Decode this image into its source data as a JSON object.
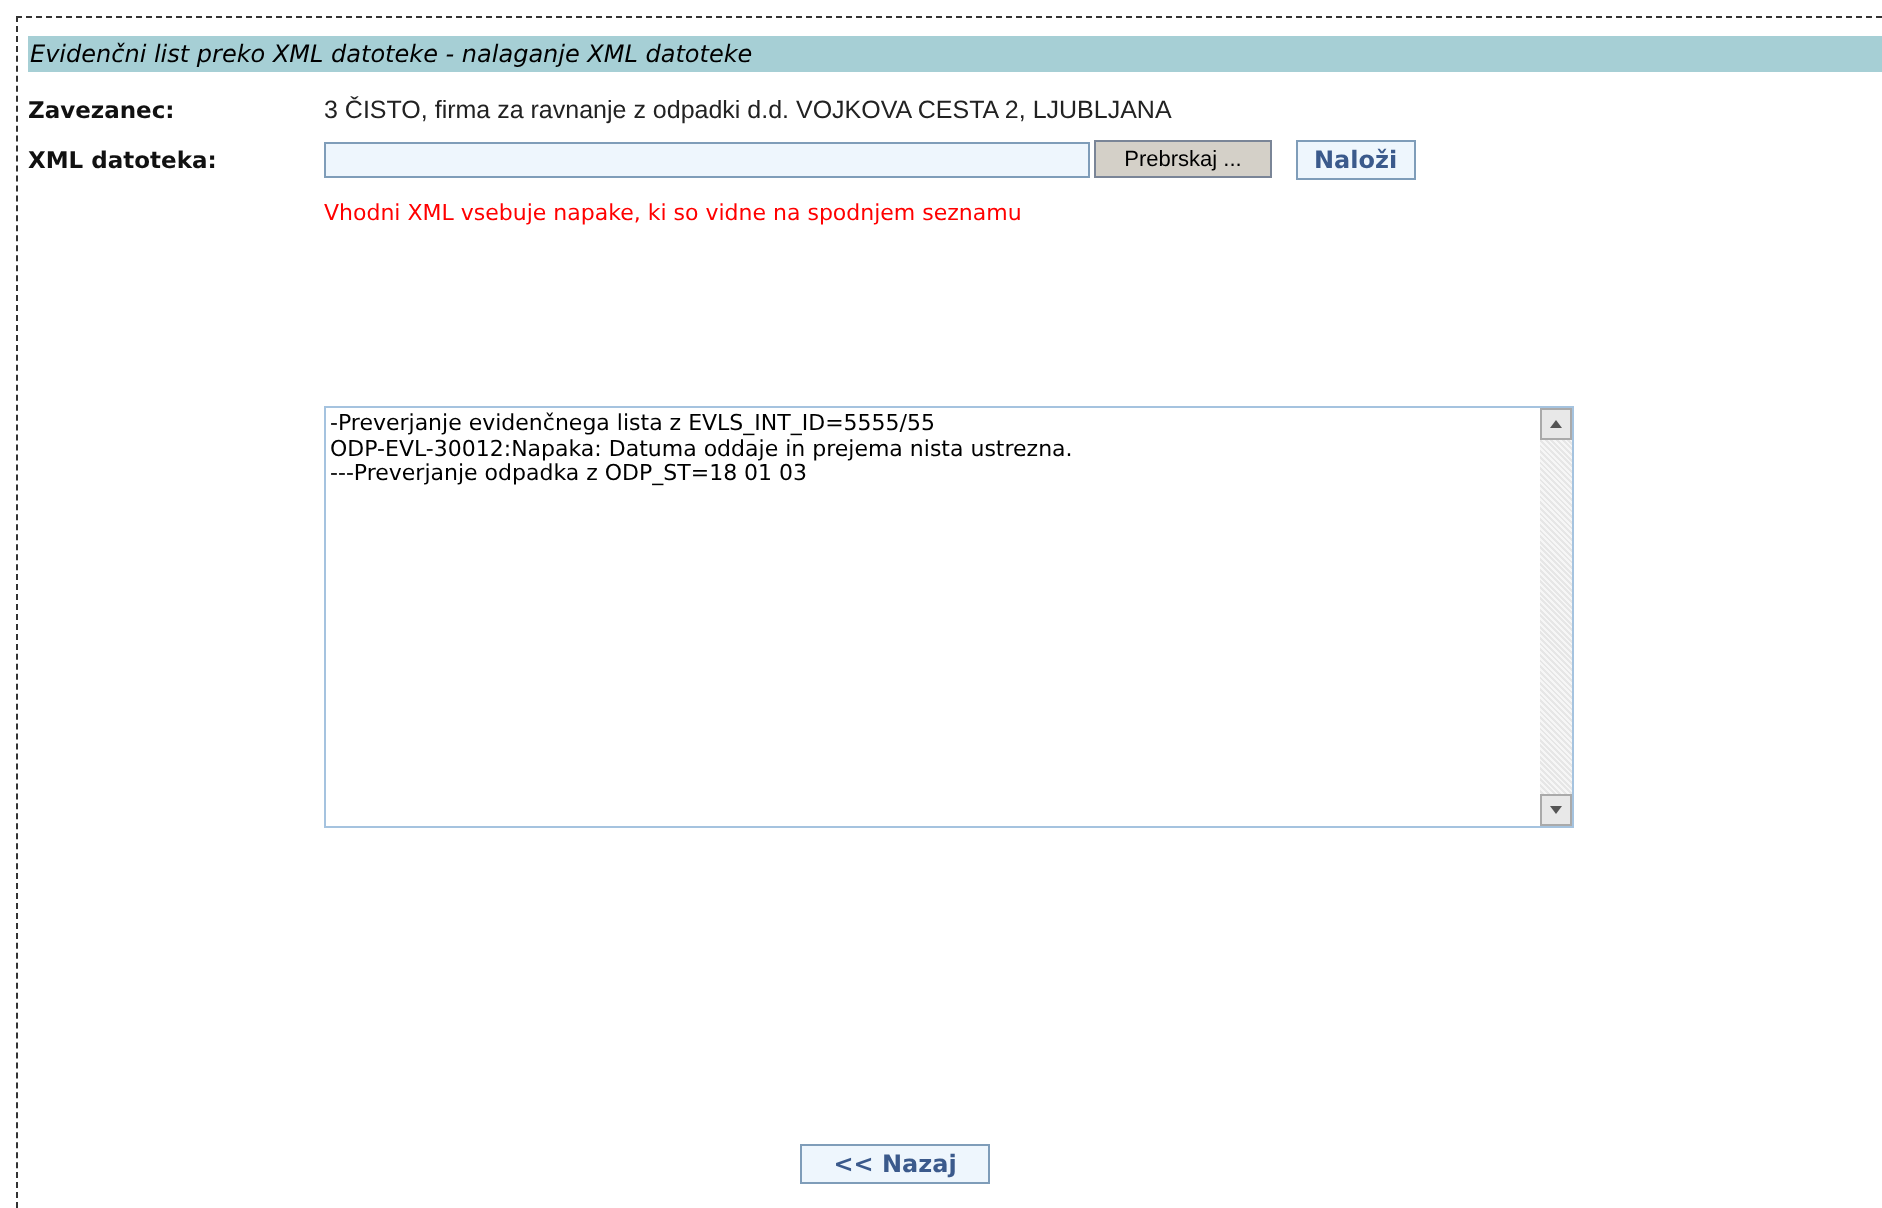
{
  "header": {
    "title": "Evidenčni list preko XML datoteke - nalaganje XML datoteke"
  },
  "fields": [
    {
      "kind": "text",
      "label": "Zavezanec:",
      "value": "3 ČISTO, firma za ravnanje z odpadki d.d. VOJKOVA CESTA 2, LJUBLJANA"
    },
    {
      "kind": "file",
      "label": "XML datoteka:",
      "browse": "Prebrskaj ...",
      "upload": "Naloži"
    }
  ],
  "error": "Vhodni XML vsebuje napake, ki so vidne na spodnjem seznamu",
  "log": [
    "-Preverjanje evidenčnega lista z EVLS_INT_ID=5555/55",
    "ODP-EVL-30012:Napaka: Datuma oddaje in prejema nista ustrezna.",
    "---Preverjanje odpadka z ODP_ST=18 01 03"
  ],
  "back": "<< Nazaj"
}
